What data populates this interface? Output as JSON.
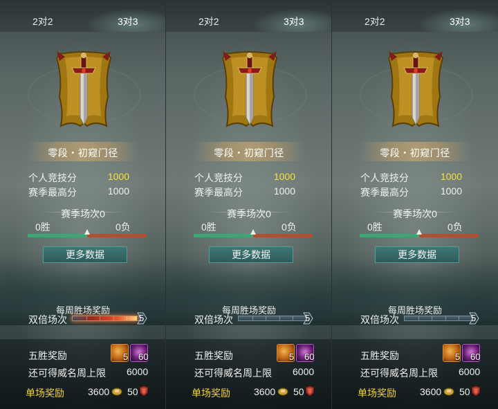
{
  "colors": {
    "highlight_gold": "#f6e03b",
    "single_reward_gold": "#f2d23a",
    "win_green": "#3aa870",
    "loss_orange": "#b0502c",
    "button_teal": "#2c5c5b",
    "banner_gold": "#b89a68"
  },
  "panels": [
    {
      "tabs": [
        {
          "label": "2对2"
        },
        {
          "label": "3对3"
        }
      ],
      "active_tab": 1,
      "emblem_icon": "sword-banner-icon",
      "rank": "零段・初窥门径",
      "personal_score_label": "个人竞技分",
      "personal_score": "1000",
      "season_high_label": "赛季最高分",
      "season_high": "1000",
      "season_matches": "赛季场次0",
      "wins": "0胜",
      "losses": "0负",
      "win_fraction": 0.5,
      "more_data_button": "更多数据",
      "weekly_title": "每周胜场奖励",
      "double_label": "双倍场次",
      "double_count": "5",
      "double_fill_fraction": 0.95,
      "double_effect": true,
      "five_win_label": "五胜奖励",
      "reward_items": [
        {
          "icon": "scroll-chest-icon",
          "count": "5"
        },
        {
          "icon": "purple-gem-icon",
          "count": "60"
        }
      ],
      "fame_label": "还可得威名周上限",
      "fame_value": "6000",
      "single_label": "单场奖励",
      "single_coin_value": "3600",
      "single_shield_value": "50"
    },
    {
      "tabs": [
        {
          "label": "2对2"
        },
        {
          "label": "3对3"
        }
      ],
      "active_tab": 1,
      "emblem_icon": "sword-banner-icon",
      "rank": "零段・初窥门径",
      "personal_score_label": "个人竞技分",
      "personal_score": "1000",
      "season_high_label": "赛季最高分",
      "season_high": "1000",
      "season_matches": "赛季场次0",
      "wins": "0胜",
      "losses": "0负",
      "win_fraction": 0.5,
      "more_data_button": "更多数据",
      "weekly_title": "每周胜场奖励",
      "double_label": "双倍场次",
      "double_count": "5",
      "double_fill_fraction": 0,
      "double_effect": false,
      "five_win_label": "五胜奖励",
      "reward_items": [
        {
          "icon": "scroll-chest-icon",
          "count": "5"
        },
        {
          "icon": "purple-gem-icon",
          "count": "60"
        }
      ],
      "fame_label": "还可得威名周上限",
      "fame_value": "6000",
      "single_label": "单场奖励",
      "single_coin_value": "3600",
      "single_shield_value": "50"
    },
    {
      "tabs": [
        {
          "label": "2对2"
        },
        {
          "label": "3对3"
        }
      ],
      "active_tab": 1,
      "emblem_icon": "sword-banner-icon",
      "rank": "零段・初窥门径",
      "personal_score_label": "个人竞技分",
      "personal_score": "1000",
      "season_high_label": "赛季最高分",
      "season_high": "1000",
      "season_matches": "赛季场次0",
      "wins": "0胜",
      "losses": "0负",
      "win_fraction": 0.5,
      "more_data_button": "更多数据",
      "weekly_title": "每周胜场奖励",
      "double_label": "双倍场次",
      "double_count": "5",
      "double_fill_fraction": 0,
      "double_effect": false,
      "five_win_label": "五胜奖励",
      "reward_items": [
        {
          "icon": "scroll-chest-icon",
          "count": "5"
        },
        {
          "icon": "purple-gem-icon",
          "count": "60"
        }
      ],
      "fame_label": "还可得威名周上限",
      "fame_value": "6000",
      "single_label": "单场奖励",
      "single_coin_value": "3600",
      "single_shield_value": "50"
    }
  ]
}
